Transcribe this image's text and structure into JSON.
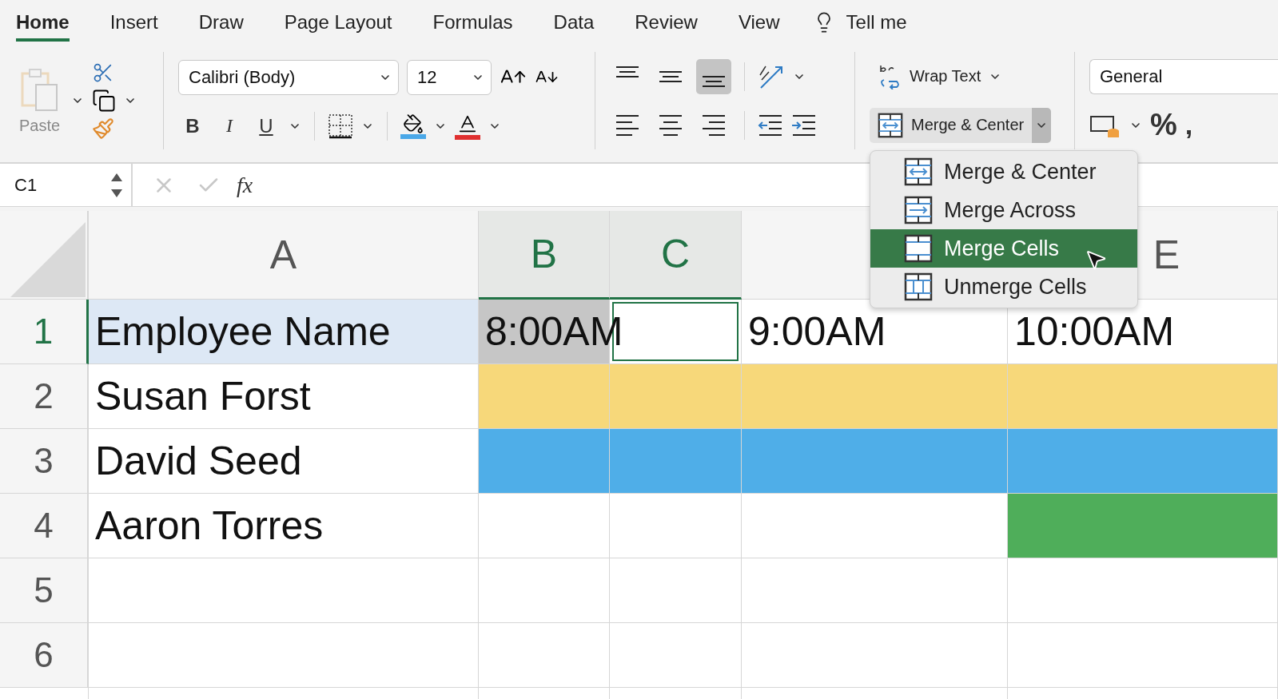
{
  "tabs": [
    {
      "label": "Home",
      "selected": true
    },
    {
      "label": "Insert",
      "selected": false
    },
    {
      "label": "Draw",
      "selected": false
    },
    {
      "label": "Page Layout",
      "selected": false
    },
    {
      "label": "Formulas",
      "selected": false
    },
    {
      "label": "Data",
      "selected": false
    },
    {
      "label": "Review",
      "selected": false
    },
    {
      "label": "View",
      "selected": false
    }
  ],
  "tell_me": "Tell me",
  "ribbon": {
    "paste": {
      "label": "Paste",
      "disabled": true
    },
    "font_name": "Calibri (Body)",
    "font_size": "12",
    "style_buttons": [
      "B",
      "I",
      "U"
    ],
    "vertical_align": [
      {
        "kind": "top",
        "selected": false
      },
      {
        "kind": "middle",
        "selected": false
      },
      {
        "kind": "bottom",
        "selected": true
      }
    ],
    "wrap_text": "Wrap Text",
    "merge": {
      "label": "Merge & Center",
      "open": true
    },
    "number_format": "General",
    "percent": "%",
    "comma": ","
  },
  "formula_bar": {
    "name_box": "C1",
    "fx": "fx"
  },
  "columns": [
    {
      "letter": "A",
      "selected": false
    },
    {
      "letter": "B",
      "selected": true
    },
    {
      "letter": "C",
      "selected": true
    },
    {
      "selected": false
    },
    {
      "letter": "E",
      "selected": false
    }
  ],
  "rows": [
    {
      "number": "1",
      "selected": true,
      "cells": [
        {
          "text": "Employee Name",
          "color": "#dde8f5"
        },
        {
          "text": "8:00AM",
          "color": "#c6c6c6"
        },
        {
          "active": true
        },
        {
          "text": "9:00AM"
        },
        {
          "text": "10:00AM"
        }
      ]
    },
    {
      "number": "2",
      "selected": false,
      "cells": [
        {
          "text": "Susan Forst"
        },
        {
          "color": "#f7d87a"
        },
        {
          "color": "#f7d87a"
        },
        {
          "color": "#f7d87a"
        },
        {
          "color": "#f7d87a"
        }
      ]
    },
    {
      "number": "3",
      "selected": false,
      "cells": [
        {
          "text": "David Seed"
        },
        {
          "color": "#4faee8"
        },
        {
          "color": "#4faee8"
        },
        {
          "color": "#4faee8"
        },
        {
          "color": "#4faee8"
        }
      ]
    },
    {
      "number": "4",
      "selected": false,
      "cells": [
        {
          "text": "Aaron Torres"
        },
        {},
        {},
        {},
        {
          "color": "#4fae5a"
        }
      ]
    },
    {
      "number": "5",
      "selected": false,
      "cells": [
        {},
        {},
        {},
        {},
        {}
      ]
    },
    {
      "number": "6",
      "selected": false,
      "cells": [
        {},
        {},
        {},
        {},
        {}
      ]
    }
  ],
  "merge_menu": {
    "items": [
      {
        "label": "Merge & Center",
        "kind": "center",
        "selected": false
      },
      {
        "label": "Merge Across",
        "kind": "across",
        "selected": false
      },
      {
        "label": "Merge Cells",
        "kind": "cells",
        "selected": true
      },
      {
        "label": "Unmerge Cells",
        "kind": "unmerge",
        "selected": false
      }
    ]
  }
}
